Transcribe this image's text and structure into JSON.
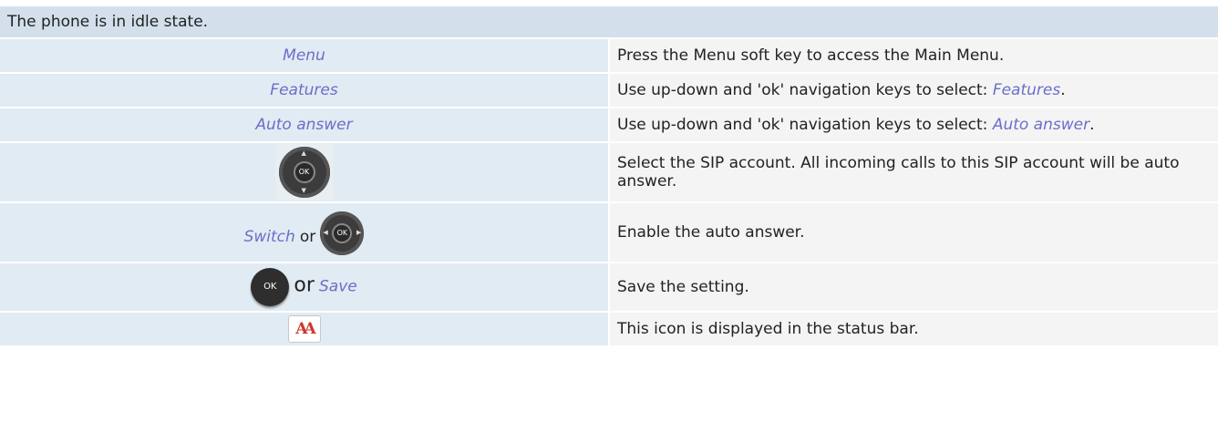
{
  "header": "The phone is in idle state.",
  "rows": [
    {
      "left_keyword": "Menu",
      "instruction": "Press the Menu soft key to access the Main Menu."
    },
    {
      "left_keyword": "Features",
      "instruction_prefix": "Use up-down and 'ok' navigation keys to select: ",
      "instruction_keyword": "Features",
      "instruction_suffix": "."
    },
    {
      "left_keyword": "Auto answer",
      "instruction_prefix": "Use up-down and 'ok' navigation keys to select: ",
      "instruction_keyword": "Auto answer",
      "instruction_suffix": "."
    },
    {
      "left_icon": "navigation-key-icon",
      "instruction": "Select the SIP account. All incoming calls to this SIP account will be auto answer."
    },
    {
      "left_keyword": "Switch",
      "left_connector": "or",
      "left_icon": "navigation-key-icon",
      "instruction": "Enable the auto answer."
    },
    {
      "left_icon": "ok-key-icon",
      "left_connector": "or",
      "left_keyword": "Save",
      "instruction": "Save the setting."
    },
    {
      "left_icon": "auto-answer-status-icon",
      "instruction": "This icon is displayed in the status bar."
    }
  ],
  "icons": {
    "ok_label": "OK",
    "aa_label": "AA"
  },
  "colors": {
    "keyword": "#6a6fc8",
    "left_cell_bg": "#e1ebf3",
    "header_bg": "#d3e0ec",
    "right_cell_bg": "#f4f4f4",
    "aa_icon": "#d0352e"
  }
}
